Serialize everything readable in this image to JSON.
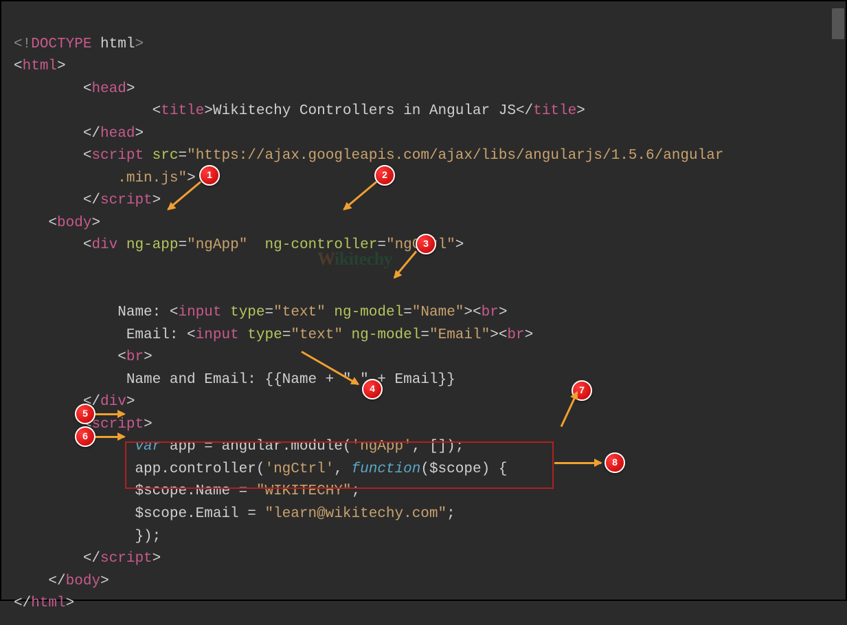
{
  "code": {
    "doctype": "<!DOCTYPE html>",
    "html_open": "html",
    "head_open": "head",
    "title_tag": "title",
    "title_text": "Wikitechy Controllers in Angular JS",
    "head_close": "head",
    "script_tag": "script",
    "src_attr": "src",
    "src_val": "\"https://ajax.googleapis.com/ajax/libs/angularjs/1.5.6/angular\n            .min.js\"",
    "body_tag": "body",
    "div_tag": "div",
    "ngapp_attr": "ng-app",
    "ngapp_val": "\"ngApp\"",
    "ngctrl_attr": "ng-controller",
    "ngctrl_val": "\"ngCtrl\"",
    "name_label": "Name: ",
    "email_label": "Email: ",
    "input_tag": "input",
    "type_attr": "type",
    "type_val": "\"text\"",
    "ngmodel_attr": "ng-model",
    "ngmodel_name": "\"Name\"",
    "ngmodel_email": "\"Email\"",
    "br_tag": "br",
    "nameemail_label": "Name and Email: ",
    "expr": "{{Name + \" \" + Email}}",
    "var_kw": "var",
    "app_var": "app",
    "module_call": " = angular.module(",
    "ngapp_str": "'ngApp'",
    "arr": ", []);",
    "ctrl_call": "app.controller(",
    "ngctrl_str": "'ngCtrl'",
    "function_kw": "function",
    "scope_param": "$scope",
    "scope_name": "$scope.Name = ",
    "wikitechy": "\"WIKITECHY\"",
    "scope_email": "$scope.Email = ",
    "email_val": "\"learn@wikitechy.com\"",
    "close_fn": "});"
  },
  "badges": {
    "b1": "1",
    "b2": "2",
    "b3": "3",
    "b4": "4",
    "b5": "5",
    "b6": "6",
    "b7": "7",
    "b8": "8"
  },
  "watermark": {
    "w": "W",
    "rest": "ikitechy"
  }
}
